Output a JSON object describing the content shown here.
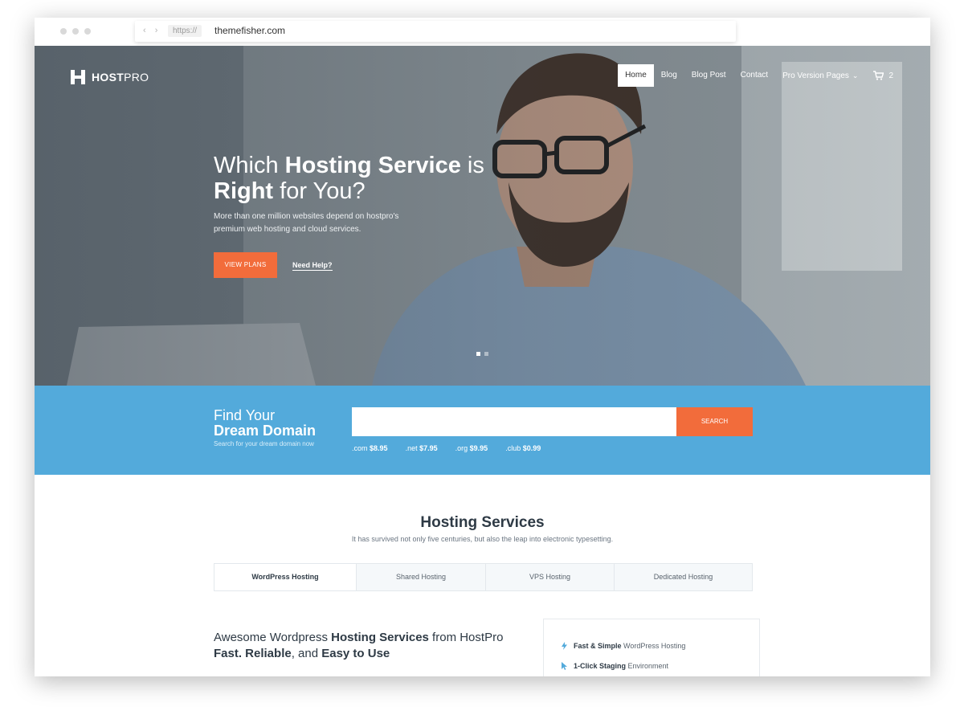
{
  "browser": {
    "protocol": "https://",
    "url": "themefisher.com"
  },
  "brand": {
    "bold": "HOST",
    "light": "PRO"
  },
  "nav": {
    "items": [
      "Home",
      "Blog",
      "Blog Post",
      "Contact",
      "Pro Version Pages"
    ],
    "cart_count": "2"
  },
  "hero": {
    "title_pre": "Which ",
    "title_bold1": "Hosting Service",
    "title_mid": " is",
    "title_bold2": "Right",
    "title_post": " for You?",
    "subtitle": "More than one million websites depend on hostpro's premium web hosting and cloud services.",
    "cta_primary": "VIEW PLANS",
    "cta_secondary": "Need Help?"
  },
  "domain": {
    "title_light": "Find Your",
    "title_bold": "Dream Domain",
    "subtitle": "Search for your dream domain now",
    "input_value": "",
    "search_label": "SEARCH",
    "tlds": [
      {
        "ext": ".com",
        "price": "$8.95"
      },
      {
        "ext": ".net",
        "price": "$7.95"
      },
      {
        "ext": ".org",
        "price": "$9.95"
      },
      {
        "ext": ".club",
        "price": "$0.99"
      }
    ]
  },
  "services": {
    "title": "Hosting Services",
    "subtitle": "It has survived not only five centuries, but also the leap into electronic typesetting.",
    "tabs": [
      "WordPress Hosting",
      "Shared Hosting",
      "VPS Hosting",
      "Dedicated Hosting"
    ],
    "feature_title_light1": "Awesome Wordpress ",
    "feature_title_bold1": "Hosting Services",
    "feature_title_light2": " from HostPro",
    "feature_title_bold2": "Fast. Reliable",
    "feature_title_light3": ", and ",
    "feature_title_bold3": "Easy to Use",
    "features": [
      {
        "bold": "Fast & Simple",
        "rest": " WordPress Hosting"
      },
      {
        "bold": "1-Click Staging",
        "rest": " Environment"
      }
    ]
  },
  "colors": {
    "accent": "#f26c3b",
    "domain_bg": "#53aadb",
    "heading": "#2e3a45"
  }
}
